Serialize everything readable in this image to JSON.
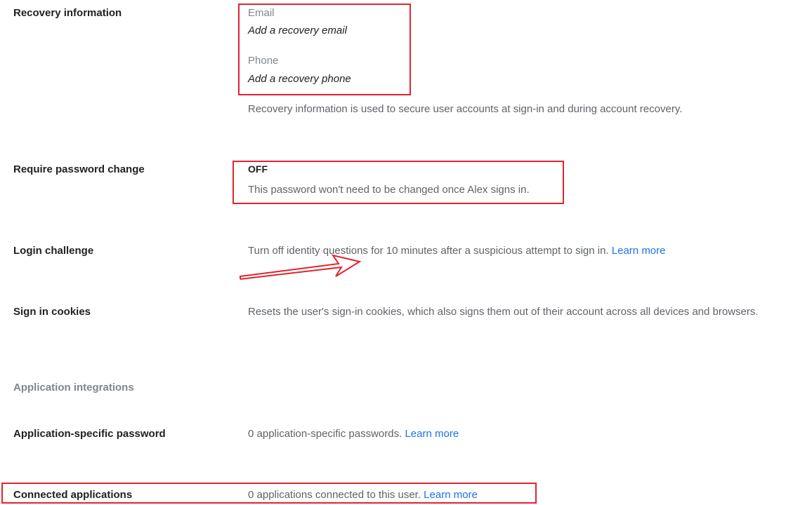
{
  "recovery": {
    "label": "Recovery information",
    "email_caption": "Email",
    "email_action": "Add a recovery email",
    "phone_caption": "Phone",
    "phone_action": "Add a recovery phone",
    "description": "Recovery information is used to secure user accounts at sign-in and during account recovery."
  },
  "password_change": {
    "label": "Require password change",
    "status": "OFF",
    "description": "This password won't need to be changed once Alex signs in."
  },
  "login_challenge": {
    "label": "Login challenge",
    "description": "Turn off identity questions for 10 minutes after a suspicious attempt to sign in.",
    "link": "Learn more"
  },
  "sign_in_cookies": {
    "label": "Sign in cookies",
    "description": "Resets the user's sign-in cookies, which also signs them out of their account across all devices and browsers."
  },
  "integrations": {
    "section_label": "Application integrations"
  },
  "app_password": {
    "label": "Application-specific password",
    "description": "0 application-specific passwords.",
    "link": "Learn more"
  },
  "connected_apps": {
    "label": "Connected applications",
    "description": "0 applications connected to this user.",
    "link": "Learn more"
  },
  "colors": {
    "annotation": "#e0242e",
    "link": "#1a73e8",
    "secondary_text": "#5f6368"
  }
}
